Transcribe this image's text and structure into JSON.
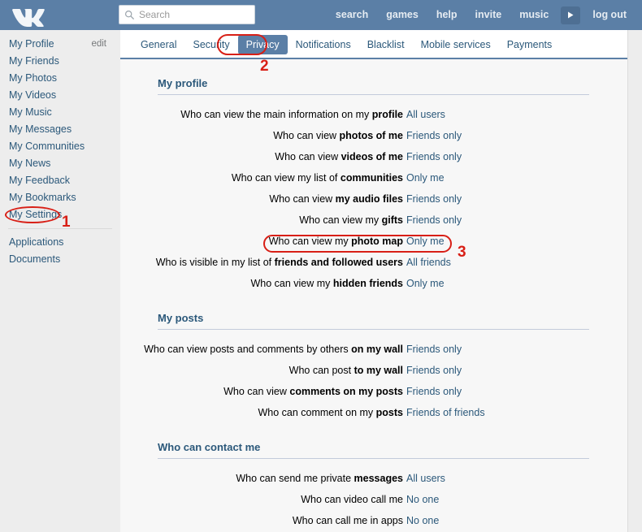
{
  "topbar": {
    "logo_name": "vk-logo",
    "search": {
      "placeholder": "Search",
      "value": ""
    },
    "nav": [
      {
        "label": "search",
        "name": "topnav-search"
      },
      {
        "label": "games",
        "name": "topnav-games"
      },
      {
        "label": "help",
        "name": "topnav-help"
      },
      {
        "label": "invite",
        "name": "topnav-invite"
      },
      {
        "label": "music",
        "name": "topnav-music"
      }
    ],
    "music_play_icon": "play-icon",
    "logout": "log out"
  },
  "sidebar": {
    "edit_label": "edit",
    "items": [
      {
        "label": "My Profile",
        "name": "sidebar-item-my-profile"
      },
      {
        "label": "My Friends",
        "name": "sidebar-item-my-friends"
      },
      {
        "label": "My Photos",
        "name": "sidebar-item-my-photos"
      },
      {
        "label": "My Videos",
        "name": "sidebar-item-my-videos"
      },
      {
        "label": "My Music",
        "name": "sidebar-item-my-music"
      },
      {
        "label": "My Messages",
        "name": "sidebar-item-my-messages"
      },
      {
        "label": "My Communities",
        "name": "sidebar-item-my-communities"
      },
      {
        "label": "My News",
        "name": "sidebar-item-my-news"
      },
      {
        "label": "My Feedback",
        "name": "sidebar-item-my-feedback"
      },
      {
        "label": "My Bookmarks",
        "name": "sidebar-item-my-bookmarks"
      },
      {
        "label": "My Settings",
        "name": "sidebar-item-my-settings"
      }
    ],
    "items_after": [
      {
        "label": "Applications",
        "name": "sidebar-item-applications"
      },
      {
        "label": "Documents",
        "name": "sidebar-item-documents"
      }
    ]
  },
  "tabs": [
    {
      "label": "General",
      "active": false
    },
    {
      "label": "Security",
      "active": false
    },
    {
      "label": "Privacy",
      "active": true
    },
    {
      "label": "Notifications",
      "active": false
    },
    {
      "label": "Blacklist",
      "active": false
    },
    {
      "label": "Mobile services",
      "active": false
    },
    {
      "label": "Payments",
      "active": false
    }
  ],
  "sections": [
    {
      "title": "My profile",
      "rows": [
        {
          "prefix": "Who can view the main information on my ",
          "bold": "profile",
          "suffix": "",
          "value": "All users"
        },
        {
          "prefix": "Who can view ",
          "bold": "photos of me",
          "suffix": "",
          "value": "Friends only"
        },
        {
          "prefix": "Who can view ",
          "bold": "videos of me",
          "suffix": "",
          "value": "Friends only"
        },
        {
          "prefix": "Who can view my list of ",
          "bold": "communities",
          "suffix": "",
          "value": "Only me"
        },
        {
          "prefix": "Who can view ",
          "bold": "my audio files",
          "suffix": "",
          "value": "Friends only"
        },
        {
          "prefix": "Who can view my ",
          "bold": "gifts",
          "suffix": "",
          "value": "Friends only"
        },
        {
          "prefix": "Who can view my ",
          "bold": "photo map",
          "suffix": "",
          "value": "Only me"
        },
        {
          "prefix": "Who is visible in my list of ",
          "bold": "friends and followed users",
          "suffix": "",
          "value": "All friends"
        },
        {
          "prefix": "Who can view my ",
          "bold": "hidden friends",
          "suffix": "",
          "value": "Only me"
        }
      ]
    },
    {
      "title": "My posts",
      "rows": [
        {
          "prefix": "Who can view posts and comments by others ",
          "bold": "on my wall",
          "suffix": "",
          "value": "Friends only"
        },
        {
          "prefix": "Who can post ",
          "bold": "to my wall",
          "suffix": "",
          "value": "Friends only"
        },
        {
          "prefix": "Who can view ",
          "bold": "comments on my posts",
          "suffix": "",
          "value": "Friends only"
        },
        {
          "prefix": "Who can comment on my ",
          "bold": "posts",
          "suffix": "",
          "value": "Friends of friends"
        }
      ]
    },
    {
      "title": "Who can contact me",
      "rows": [
        {
          "prefix": "Who can send me private ",
          "bold": "messages",
          "suffix": "",
          "value": "All users"
        },
        {
          "prefix": "Who can video call me",
          "bold": "",
          "suffix": "",
          "value": "No one"
        },
        {
          "prefix": "Who can call me in apps",
          "bold": "",
          "suffix": "",
          "value": "No one"
        }
      ]
    }
  ],
  "annotations": [
    {
      "number": "1",
      "target": "my-settings-sidebar-item"
    },
    {
      "number": "2",
      "target": "privacy-tab"
    },
    {
      "number": "3",
      "target": "photo-map-row"
    }
  ]
}
